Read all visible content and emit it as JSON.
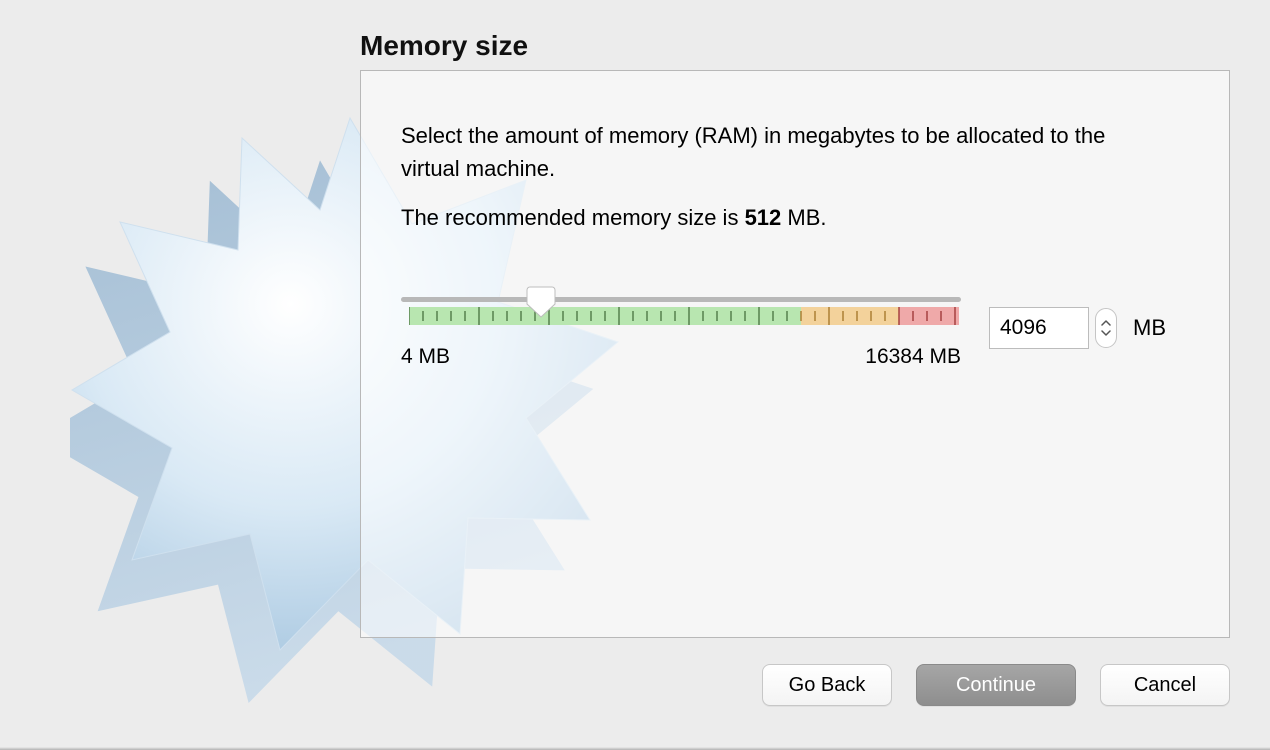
{
  "title": "Memory size",
  "description": "Select the amount of memory (RAM) in megabytes to be allocated to the virtual machine.",
  "recommendation": {
    "prefix": "The recommended memory size is ",
    "value": "512",
    "suffix": " MB."
  },
  "slider": {
    "min_label": "4 MB",
    "max_label": "16384 MB",
    "value": "4096",
    "unit": "MB"
  },
  "buttons": {
    "back": "Go Back",
    "continue": "Continue",
    "cancel": "Cancel"
  }
}
